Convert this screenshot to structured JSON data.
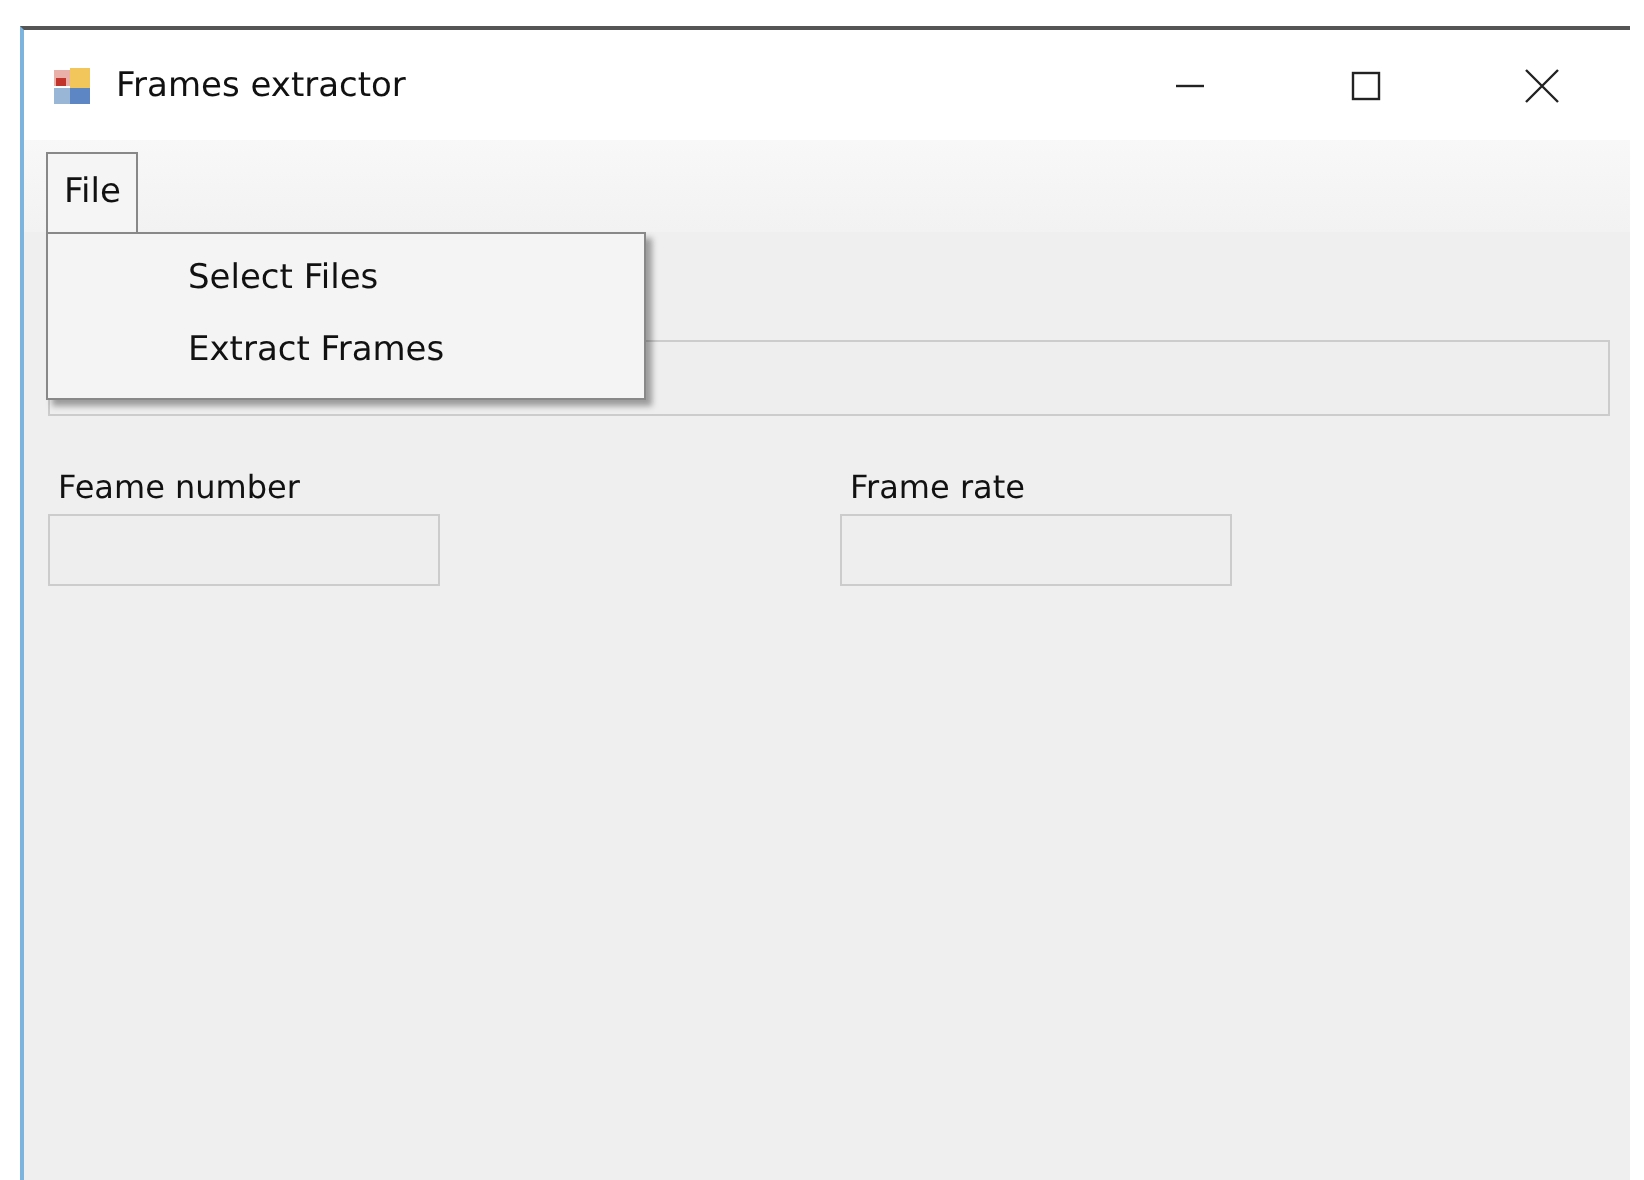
{
  "window": {
    "title": "Frames extractor"
  },
  "menu": [
    {
      "label": "File",
      "expanded": true,
      "items": [
        {
          "label": "Select Files"
        },
        {
          "label": "Extract Frames"
        }
      ]
    }
  ],
  "fields": [
    {
      "label": "Feame number"
    },
    {
      "label": "Frame rate"
    }
  ]
}
